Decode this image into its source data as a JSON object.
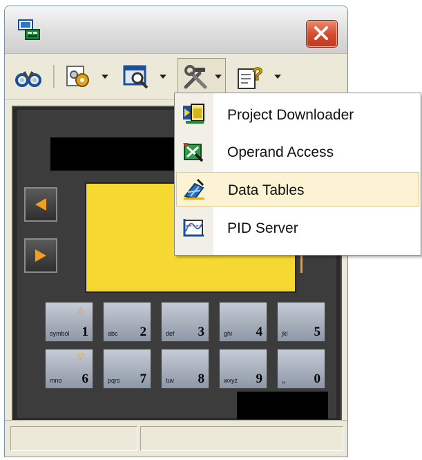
{
  "window": {
    "title": ""
  },
  "toolbar": {
    "buttons": [
      {
        "name": "find",
        "icon": "binoculars-icon"
      },
      {
        "name": "settings",
        "icon": "gear-tools-icon"
      },
      {
        "name": "view",
        "icon": "magnifier-window-icon"
      },
      {
        "name": "tools",
        "icon": "hammer-wrench-icon"
      },
      {
        "name": "help",
        "icon": "help-document-icon"
      }
    ]
  },
  "menu": {
    "items": [
      {
        "label": "Project Downloader",
        "icon": "project-downloader-icon",
        "highlighted": false
      },
      {
        "label": "Operand Access",
        "icon": "operand-access-icon",
        "highlighted": false
      },
      {
        "label": "Data Tables",
        "icon": "data-tables-icon",
        "highlighted": true
      },
      {
        "label": "PID Server",
        "icon": "pid-server-icon",
        "highlighted": false
      }
    ]
  },
  "keypad": {
    "row1": [
      {
        "letters": "symbol",
        "digit": "1"
      },
      {
        "letters": "abc",
        "digit": "2"
      },
      {
        "letters": "def",
        "digit": "3"
      },
      {
        "letters": "ghi",
        "digit": "4"
      },
      {
        "letters": "jkl",
        "digit": "5"
      }
    ],
    "row2": [
      {
        "letters": "mno",
        "digit": "6"
      },
      {
        "letters": "pqrs",
        "digit": "7"
      },
      {
        "letters": "tuv",
        "digit": "8"
      },
      {
        "letters": "wxyz",
        "digit": "9"
      },
      {
        "letters": "␣",
        "digit": "0"
      }
    ]
  },
  "colors": {
    "screen": "#f6d832",
    "menu_highlight": "#fcf3d4",
    "close_button": "#d5482d",
    "nav_arrow": "#f0a020"
  }
}
